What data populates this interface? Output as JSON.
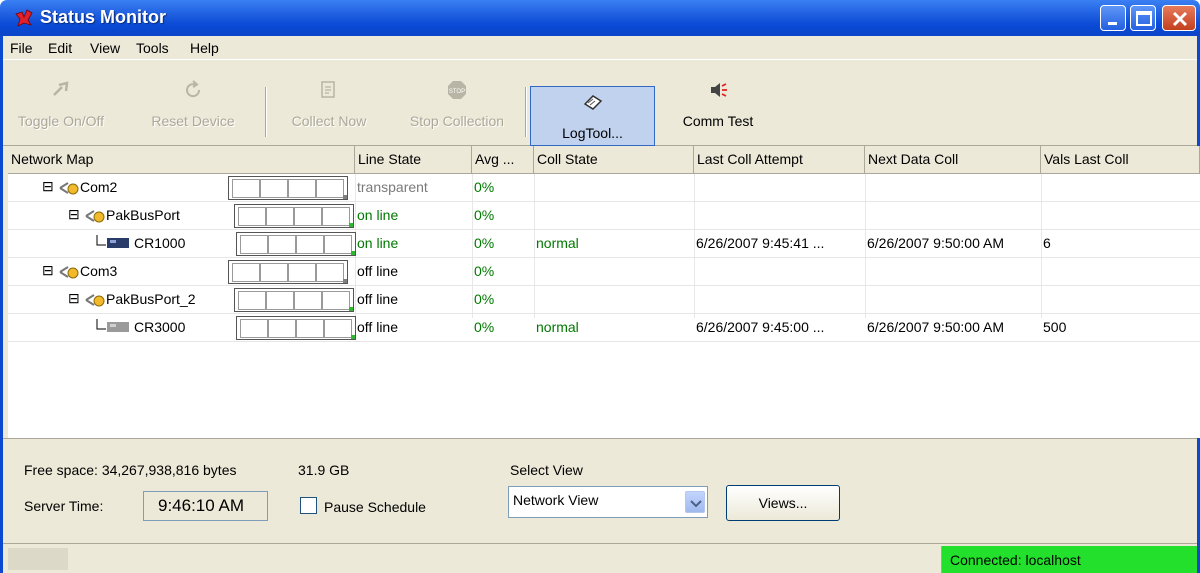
{
  "window": {
    "title": "Status Monitor",
    "controls": [
      "minimize",
      "maximize",
      "close"
    ]
  },
  "menu": {
    "items": [
      "File",
      "Edit",
      "View",
      "Tools",
      "Help"
    ]
  },
  "toolbar": {
    "buttons": [
      {
        "label": "Toggle On/Off",
        "icon": "toggle-icon",
        "enabled": false
      },
      {
        "label": "Reset Device",
        "icon": "reset-icon",
        "enabled": false
      },
      {
        "label": "Collect Now",
        "icon": "collect-icon",
        "enabled": false
      },
      {
        "label": "Stop Collection",
        "icon": "stop-icon",
        "enabled": false
      },
      {
        "label": "LogTool...",
        "icon": "logtool-icon",
        "enabled": true,
        "active": true
      },
      {
        "label": "Comm Test",
        "icon": "comm-test-icon",
        "enabled": true
      }
    ]
  },
  "grid": {
    "columns": [
      "Network Map",
      "Line State",
      "Avg ...",
      "Coll State",
      "Last Coll Attempt",
      "Next Data Coll",
      "Vals Last Coll"
    ],
    "rows": [
      {
        "name": "Com2",
        "expander": "⊟",
        "line_state": "transparent",
        "avg": "0%",
        "coll_state": "",
        "last_attempt": "",
        "next_coll": "",
        "vals": ""
      },
      {
        "name": "PakBusPort",
        "expander": "⊟",
        "line_state": "on line",
        "avg": "0%",
        "coll_state": "",
        "last_attempt": "",
        "next_coll": "",
        "vals": ""
      },
      {
        "name": "CR1000",
        "expander": "",
        "line_state": "on line",
        "avg": "0%",
        "coll_state": "normal",
        "last_attempt": "6/26/2007 9:45:41 ...",
        "next_coll": "6/26/2007 9:50:00 AM",
        "vals": "6"
      },
      {
        "name": "Com3",
        "expander": "⊟",
        "line_state": "off line",
        "avg": "0%",
        "coll_state": "",
        "last_attempt": "",
        "next_coll": "",
        "vals": ""
      },
      {
        "name": "PakBusPort_2",
        "expander": "⊟",
        "line_state": "off line",
        "avg": "0%",
        "coll_state": "",
        "last_attempt": "",
        "next_coll": "",
        "vals": ""
      },
      {
        "name": "CR3000",
        "expander": "",
        "line_state": "off line",
        "avg": "0%",
        "coll_state": "normal",
        "last_attempt": "6/26/2007 9:45:00 ...",
        "next_coll": "6/26/2007 9:50:00 AM",
        "vals": "500"
      }
    ]
  },
  "status": {
    "free_space": "Free space: 34,267,938,816 bytes",
    "free_space_gb": "31.9 GB",
    "server_time_label": "Server Time:",
    "server_time": "9:46:10 AM",
    "pause_label": "Pause Schedule",
    "select_view_label": "Select View",
    "select_view_value": "Network View",
    "views_button": "Views..."
  },
  "statusbar": {
    "connection": "Connected: localhost"
  },
  "colors": {
    "title_bar": "#0b4ad0",
    "online_text": "#007a00",
    "transparent_text": "#7a7a7a",
    "connected_bg": "#22e02b"
  }
}
